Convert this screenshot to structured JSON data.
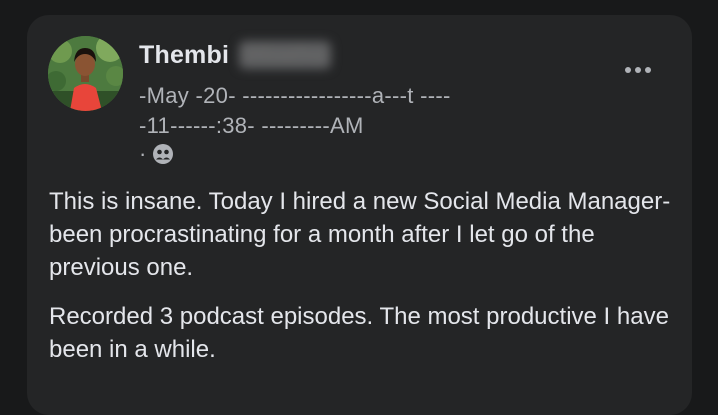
{
  "post": {
    "author_first_name": "Thembi",
    "author_last_name_blurred": "Mbatha",
    "timestamp_line1": "-May -20- -----------------a---t ----",
    "timestamp_line2": "-11------:38- ---------AM",
    "audience_separator": "·",
    "audience_icon": "friends-icon",
    "more_icon": "more-options-icon",
    "paragraphs": [
      "This is insane. Today I hired a new Social Media Manager- been procrastinating for a month after I let go of the previous one.",
      "Recorded 3 podcast episodes. The most productive I have been in a while."
    ]
  },
  "colors": {
    "page_background": "#18191a",
    "card_background": "#242526",
    "primary_text": "#e4e6eb",
    "secondary_text": "#b0b3b8"
  }
}
